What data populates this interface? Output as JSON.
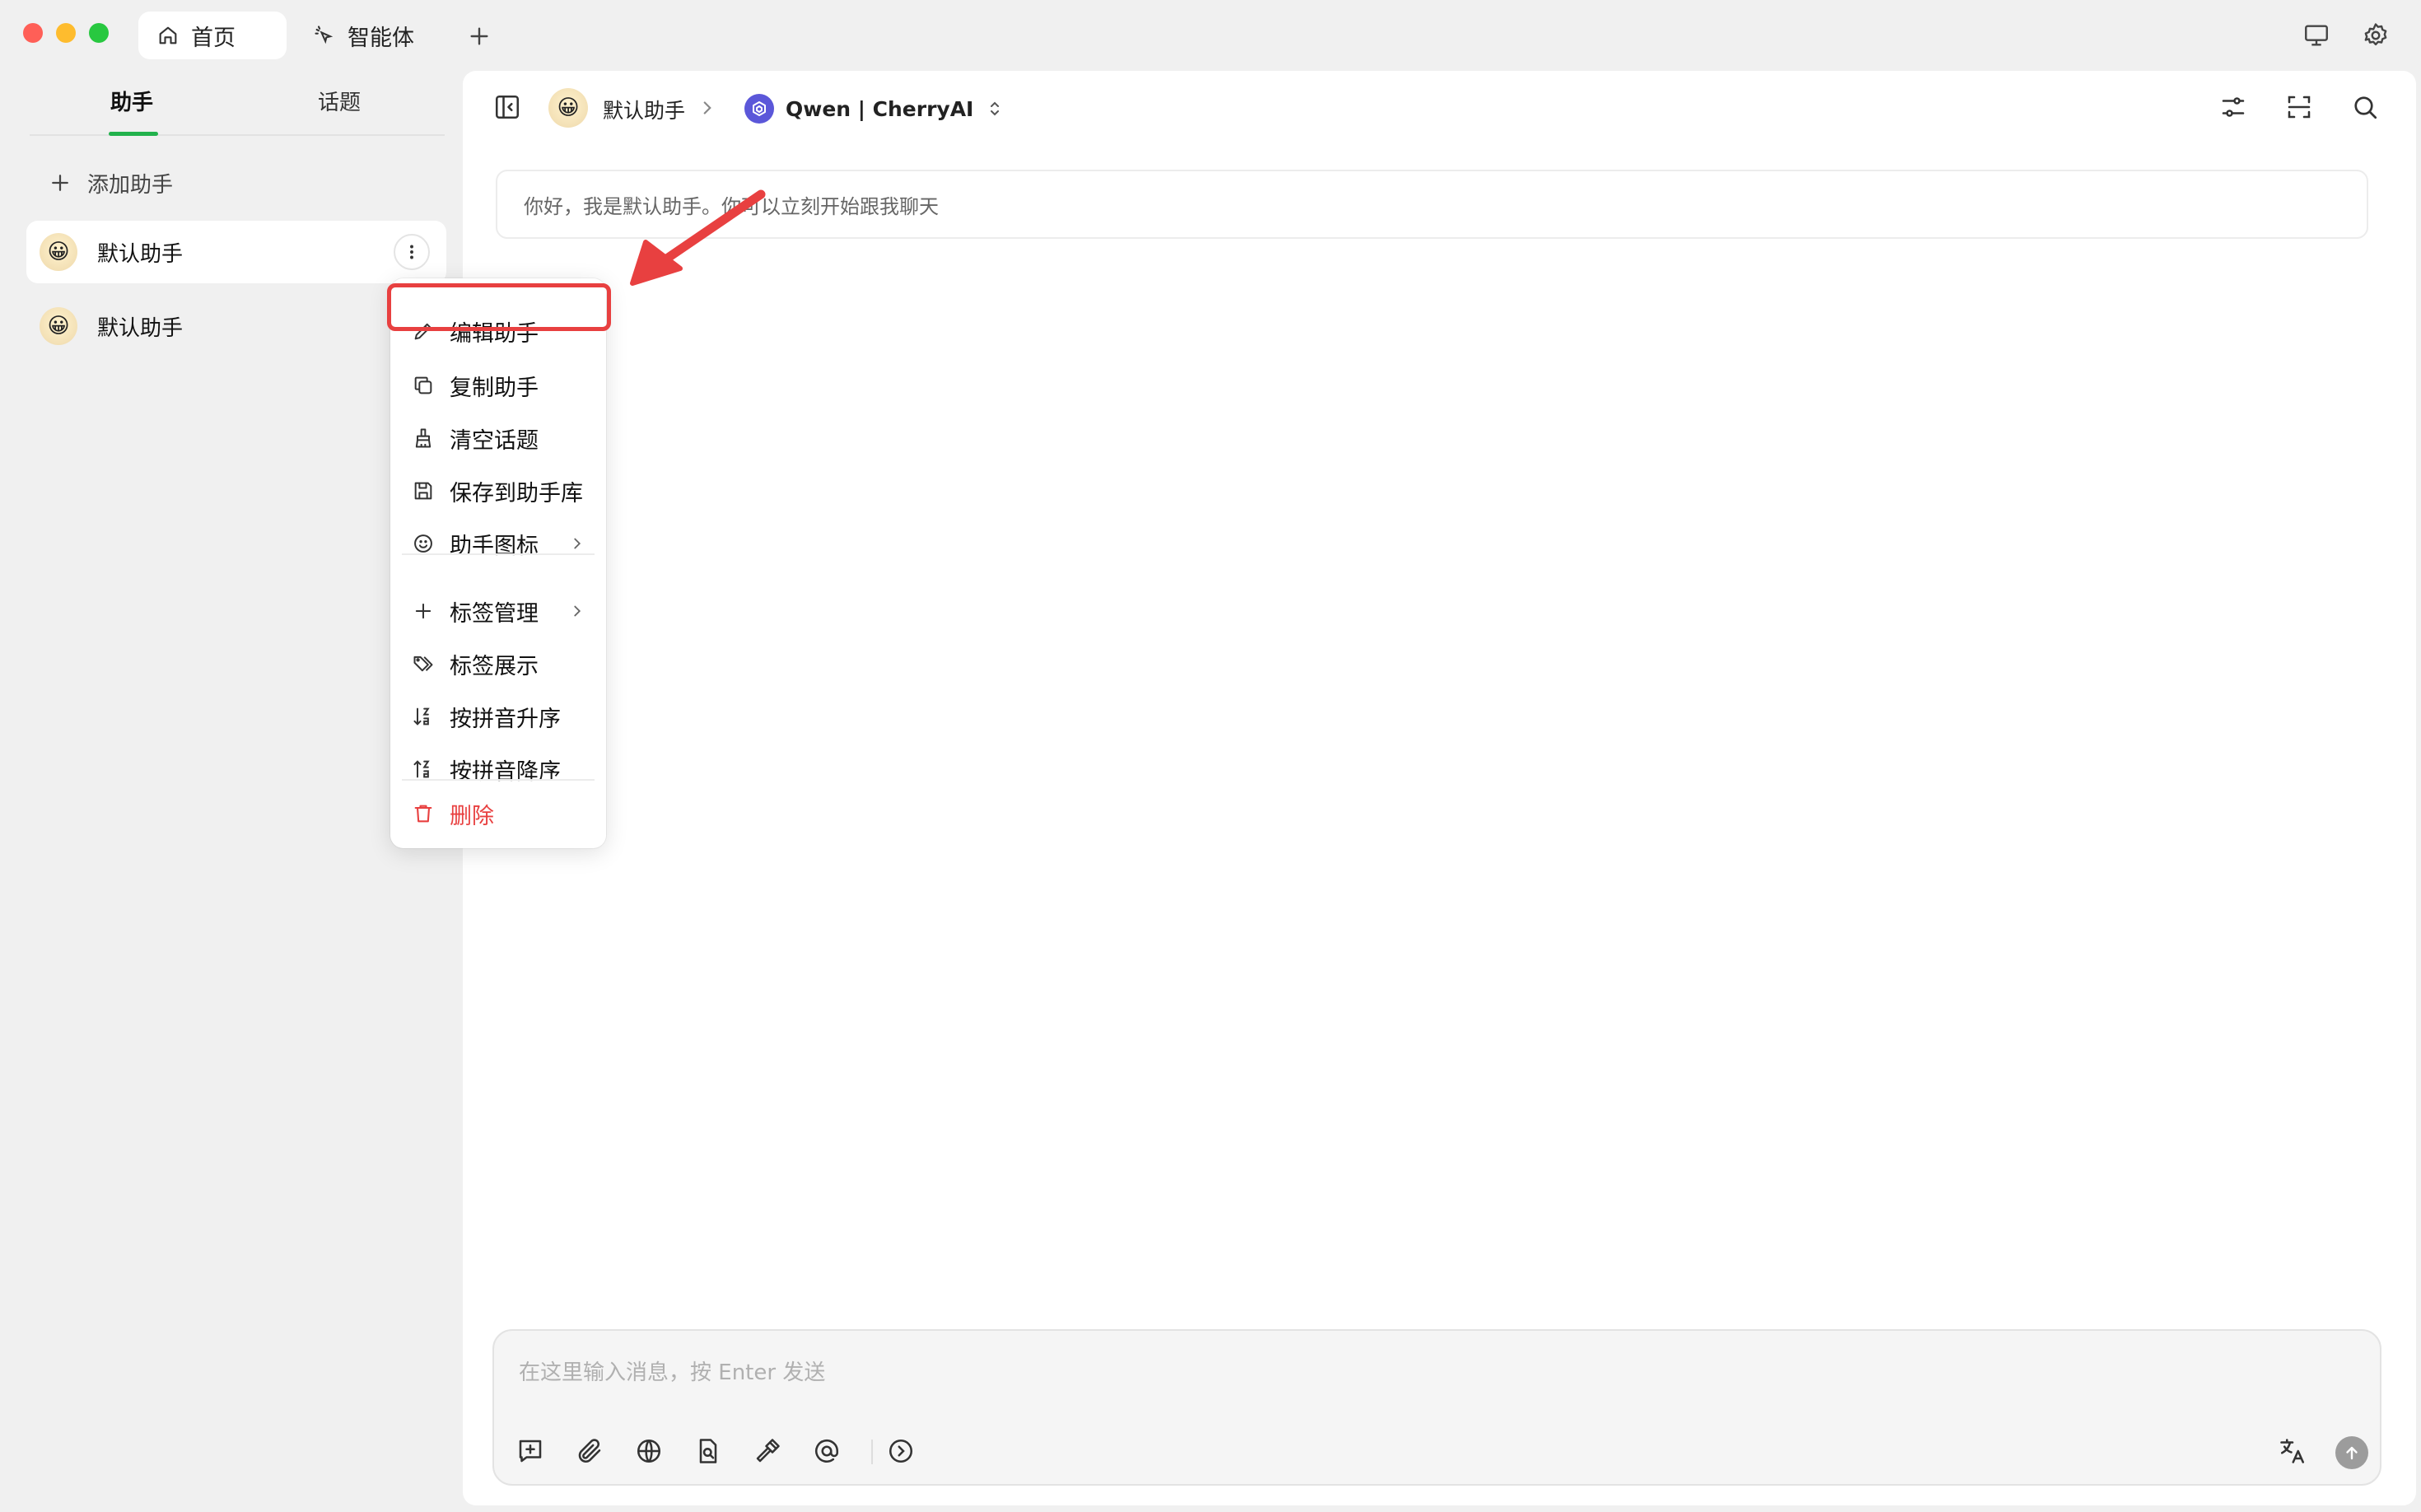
{
  "window": {
    "tabs": [
      {
        "label": "首页",
        "icon": "home-icon",
        "active": true
      },
      {
        "label": "智能体",
        "icon": "agent-sparkle-icon",
        "active": false
      }
    ],
    "add_tab_icon": "plus-icon",
    "right_icons": [
      "monitor-icon",
      "gear-icon"
    ],
    "traffic_lights": {
      "close": "#ff5f57",
      "minimize": "#febc2e",
      "maximize": "#28c840"
    }
  },
  "sidebar": {
    "tabs": [
      {
        "label": "助手",
        "active": true
      },
      {
        "label": "话题",
        "active": false
      }
    ],
    "add_assistant": "添加助手",
    "assistants": [
      {
        "name": "默认助手",
        "avatar": "😀",
        "selected": true
      },
      {
        "name": "默认助手",
        "avatar": "😀",
        "selected": false
      }
    ],
    "accent": "#22b24c"
  },
  "header": {
    "assistant_name": "默认助手",
    "avatar": "😀",
    "model": "Qwen | CherryAI",
    "right_icons": [
      "sliders-icon",
      "fullscreen-icon",
      "search-icon"
    ]
  },
  "chat": {
    "welcome": "你好，我是默认助手。你可以立刻开始跟我聊天"
  },
  "composer": {
    "placeholder": "在这里输入消息，按 Enter 发送",
    "tools": [
      "new-topic-icon",
      "attachment-icon",
      "web-search-icon",
      "knowledge-icon",
      "tools-hammer-icon",
      "mention-icon",
      "expand-icon"
    ],
    "right_tools": [
      "translate-icon",
      "send-icon"
    ]
  },
  "context_menu": {
    "items": [
      {
        "label": "编辑助手",
        "icon": "edit-icon"
      },
      {
        "label": "复制助手",
        "icon": "copy-icon"
      },
      {
        "label": "清空话题",
        "icon": "broom-icon"
      },
      {
        "label": "保存到助手库",
        "icon": "save-icon"
      },
      {
        "label": "助手图标",
        "icon": "smile-icon",
        "submenu": true
      },
      {
        "label": "标签管理",
        "icon": "plus-icon",
        "submenu": true
      },
      {
        "label": "标签展示",
        "icon": "tags-icon"
      },
      {
        "label": "按拼音升序",
        "icon": "sort-asc-icon"
      },
      {
        "label": "按拼音降序",
        "icon": "sort-desc-icon"
      },
      {
        "label": "删除",
        "icon": "trash-icon",
        "danger": true
      }
    ],
    "danger_color": "#e84040"
  },
  "annotation": {
    "highlight_color": "#e84040"
  }
}
